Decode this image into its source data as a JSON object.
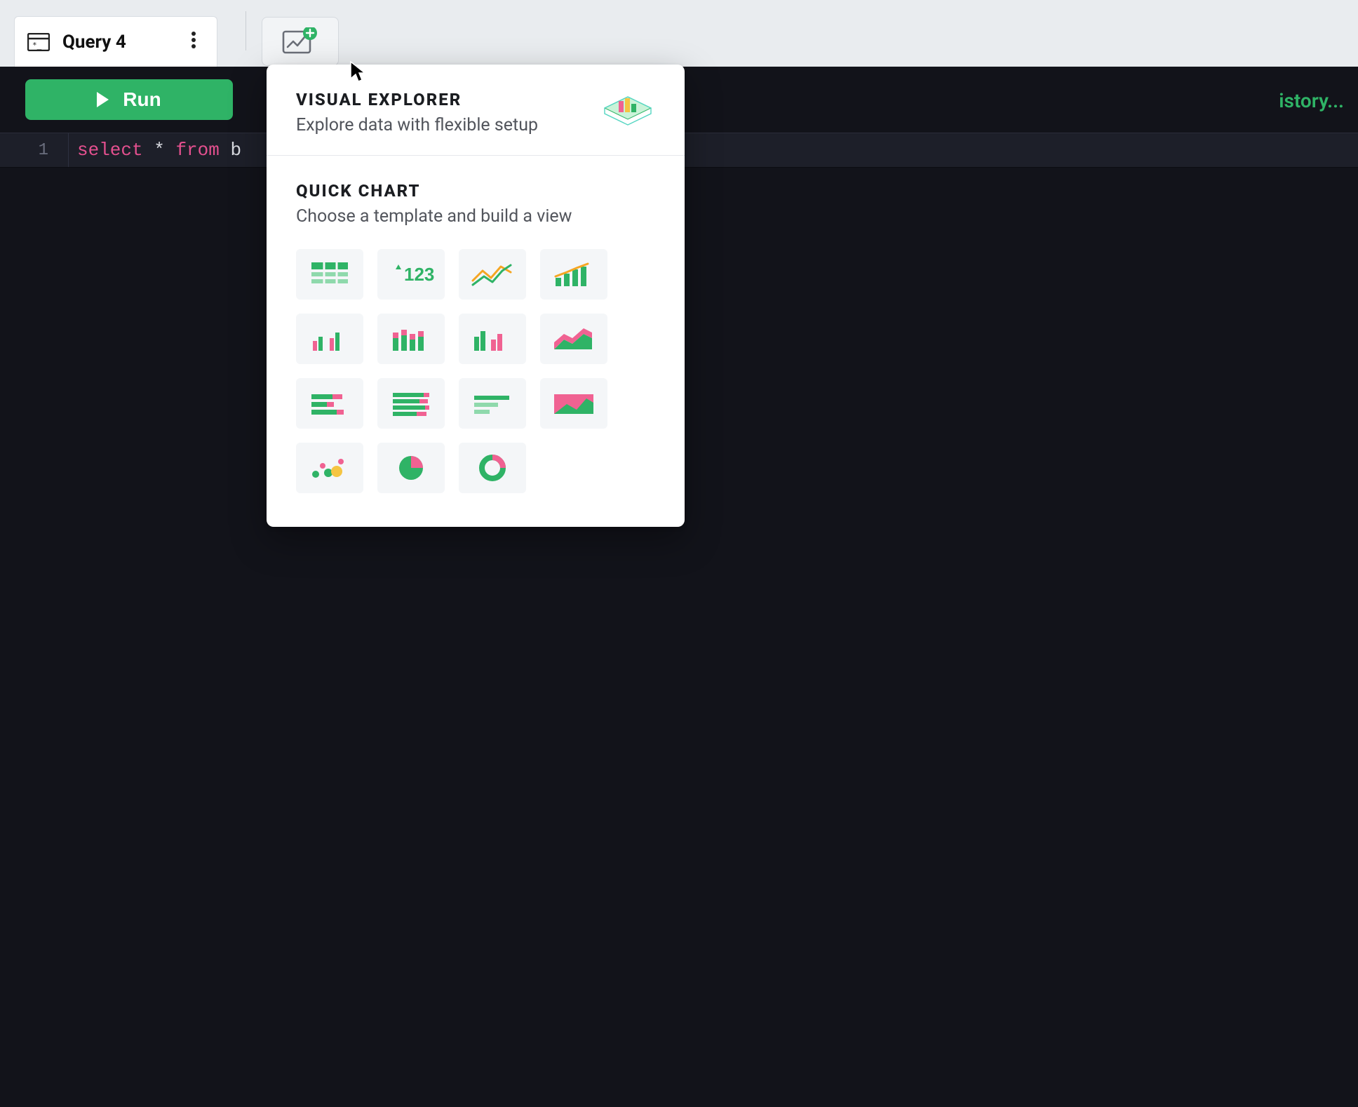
{
  "tab": {
    "label": "Query 4"
  },
  "toolbar": {
    "run_label": "Run",
    "history_label": "istory..."
  },
  "editor": {
    "line_number": "1",
    "tokens": {
      "select": "select",
      "star": "*",
      "from": "from",
      "ident": "b"
    }
  },
  "popover": {
    "visual_explorer": {
      "title": "VISUAL EXPLORER",
      "subtitle": "Explore data with flexible setup"
    },
    "quick_chart": {
      "title": "QUICK CHART",
      "subtitle": "Choose a template and build a view",
      "big_number_label": "123"
    },
    "chart_types": [
      "table",
      "big-number",
      "line",
      "bar-line-combo",
      "grouped-bar",
      "stacked-bar",
      "clustered-bar",
      "area",
      "horizontal-bar-1",
      "horizontal-bar-2",
      "horizontal-bar-simple",
      "filled-area",
      "scatter",
      "pie",
      "donut"
    ]
  },
  "colors": {
    "green": "#2fb366",
    "green_light": "#8fd9ac",
    "pink": "#f06292",
    "orange": "#f5a623",
    "yellow": "#f5c542",
    "teal": "#55d6c2"
  }
}
